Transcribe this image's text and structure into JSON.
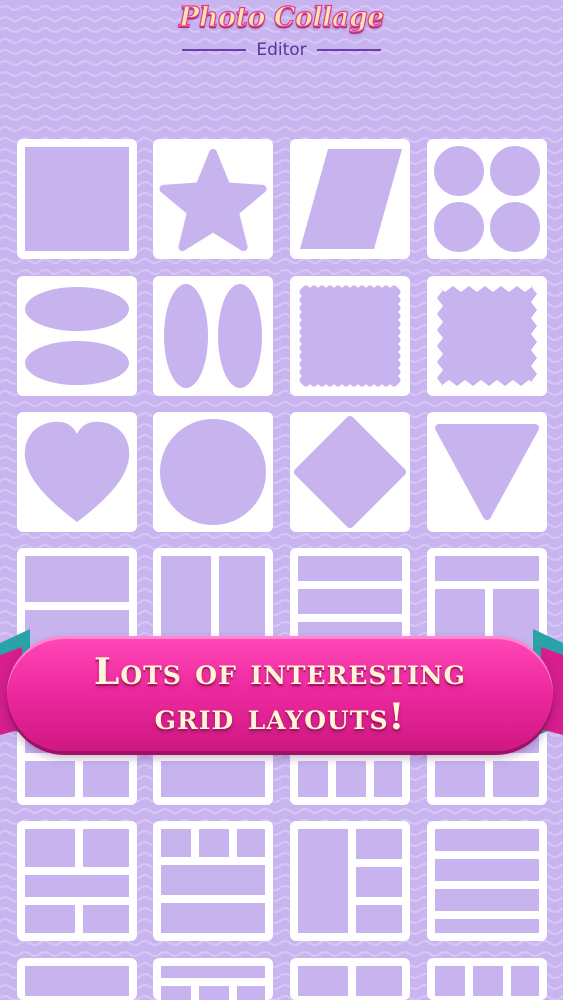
{
  "app": {
    "logo_title": "Photo Collage",
    "logo_subtitle": "Editor"
  },
  "banner": {
    "line1": "Lots of interesting",
    "line2": "grid layouts!"
  },
  "colors": {
    "background": "#c7b3ee",
    "tile": "#ffffff",
    "cut": "#c7b3ee",
    "banner": "#ef2aa0",
    "ribbon": "#2aa3a8"
  },
  "layouts": [
    {
      "name": "layout-square-tile",
      "icon": "square-icon"
    },
    {
      "name": "layout-star-tile",
      "icon": "star-icon"
    },
    {
      "name": "layout-parallelogram-tile",
      "icon": "parallelogram-icon"
    },
    {
      "name": "layout-four-circles-tile",
      "icon": "four-circles-icon"
    },
    {
      "name": "layout-two-horizontal-ellipses-tile",
      "icon": "horizontal-ellipses-icon"
    },
    {
      "name": "layout-two-vertical-ellipses-tile",
      "icon": "vertical-ellipses-icon"
    },
    {
      "name": "layout-stamp-square-tile",
      "icon": "stamp-square-icon"
    },
    {
      "name": "layout-jagged-square-tile",
      "icon": "jagged-square-icon"
    },
    {
      "name": "layout-heart-tile",
      "icon": "heart-icon"
    },
    {
      "name": "layout-circle-tile",
      "icon": "circle-icon"
    },
    {
      "name": "layout-diamond-tile",
      "icon": "diamond-icon"
    },
    {
      "name": "layout-triangle-tile",
      "icon": "triangle-icon"
    },
    {
      "name": "layout-grid-top-bottom-split-tile",
      "icon": "grid-layout-icon"
    },
    {
      "name": "layout-grid-two-columns-tile",
      "icon": "grid-layout-icon"
    },
    {
      "name": "layout-grid-stacked-rows-tile",
      "icon": "grid-layout-icon"
    },
    {
      "name": "layout-grid-mixed-rows-tile",
      "icon": "grid-layout-icon"
    },
    {
      "name": "layout-grid-bottom-a-tile",
      "icon": "grid-layout-icon"
    },
    {
      "name": "layout-grid-bottom-b-tile",
      "icon": "grid-layout-icon"
    },
    {
      "name": "layout-grid-bottom-c-tile",
      "icon": "grid-layout-icon"
    },
    {
      "name": "layout-grid-bottom-d-tile",
      "icon": "grid-layout-icon"
    },
    {
      "name": "layout-grid-five-tile",
      "icon": "grid-layout-icon"
    },
    {
      "name": "layout-grid-top-three-tile",
      "icon": "grid-layout-icon"
    },
    {
      "name": "layout-grid-left-tall-tile",
      "icon": "grid-layout-icon"
    },
    {
      "name": "layout-grid-four-rows-tile",
      "icon": "grid-layout-icon"
    },
    {
      "name": "layout-grid-partial-a-tile",
      "icon": "grid-layout-icon"
    },
    {
      "name": "layout-grid-partial-b-tile",
      "icon": "grid-layout-icon"
    },
    {
      "name": "layout-grid-partial-c-tile",
      "icon": "grid-layout-icon"
    },
    {
      "name": "layout-grid-partial-d-tile",
      "icon": "grid-layout-icon"
    }
  ]
}
